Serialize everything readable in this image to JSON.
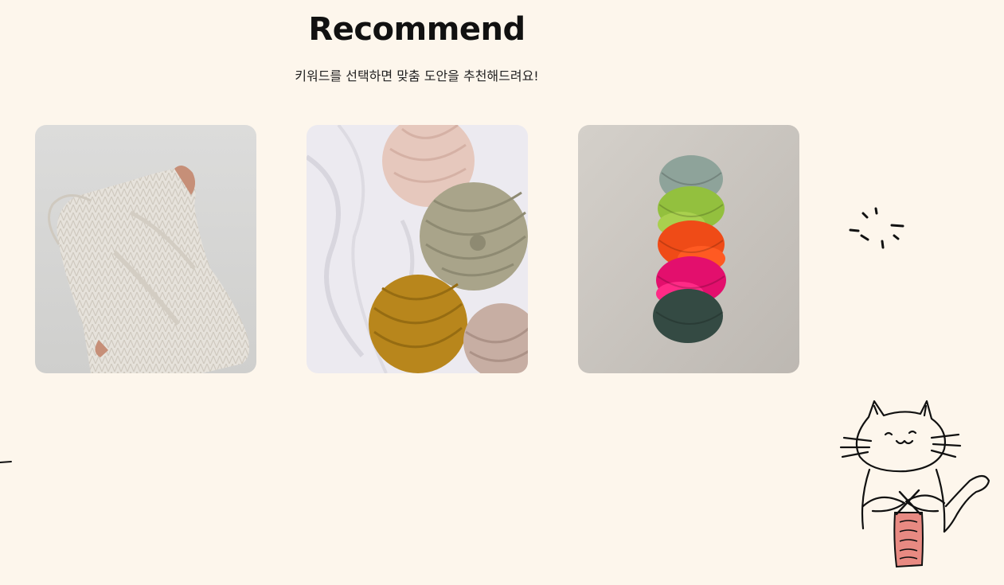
{
  "section": {
    "title": "Recommend",
    "subtitle": "키워드를 선택하면 맞춤 도안을 추천해드려요!"
  },
  "cards": [
    {
      "name": "sweater-photo",
      "alt": "person pulling on a cream knit sweater"
    },
    {
      "name": "yarn-balls-photo",
      "alt": "yarn balls in pink, sage, mustard and taupe on white linen"
    },
    {
      "name": "braided-yarn-photo",
      "alt": "braided multicolour yarn skein"
    }
  ],
  "colors": {
    "background": "#fdf6ec",
    "title": "#111111",
    "accent_pink": "#e88a82"
  }
}
